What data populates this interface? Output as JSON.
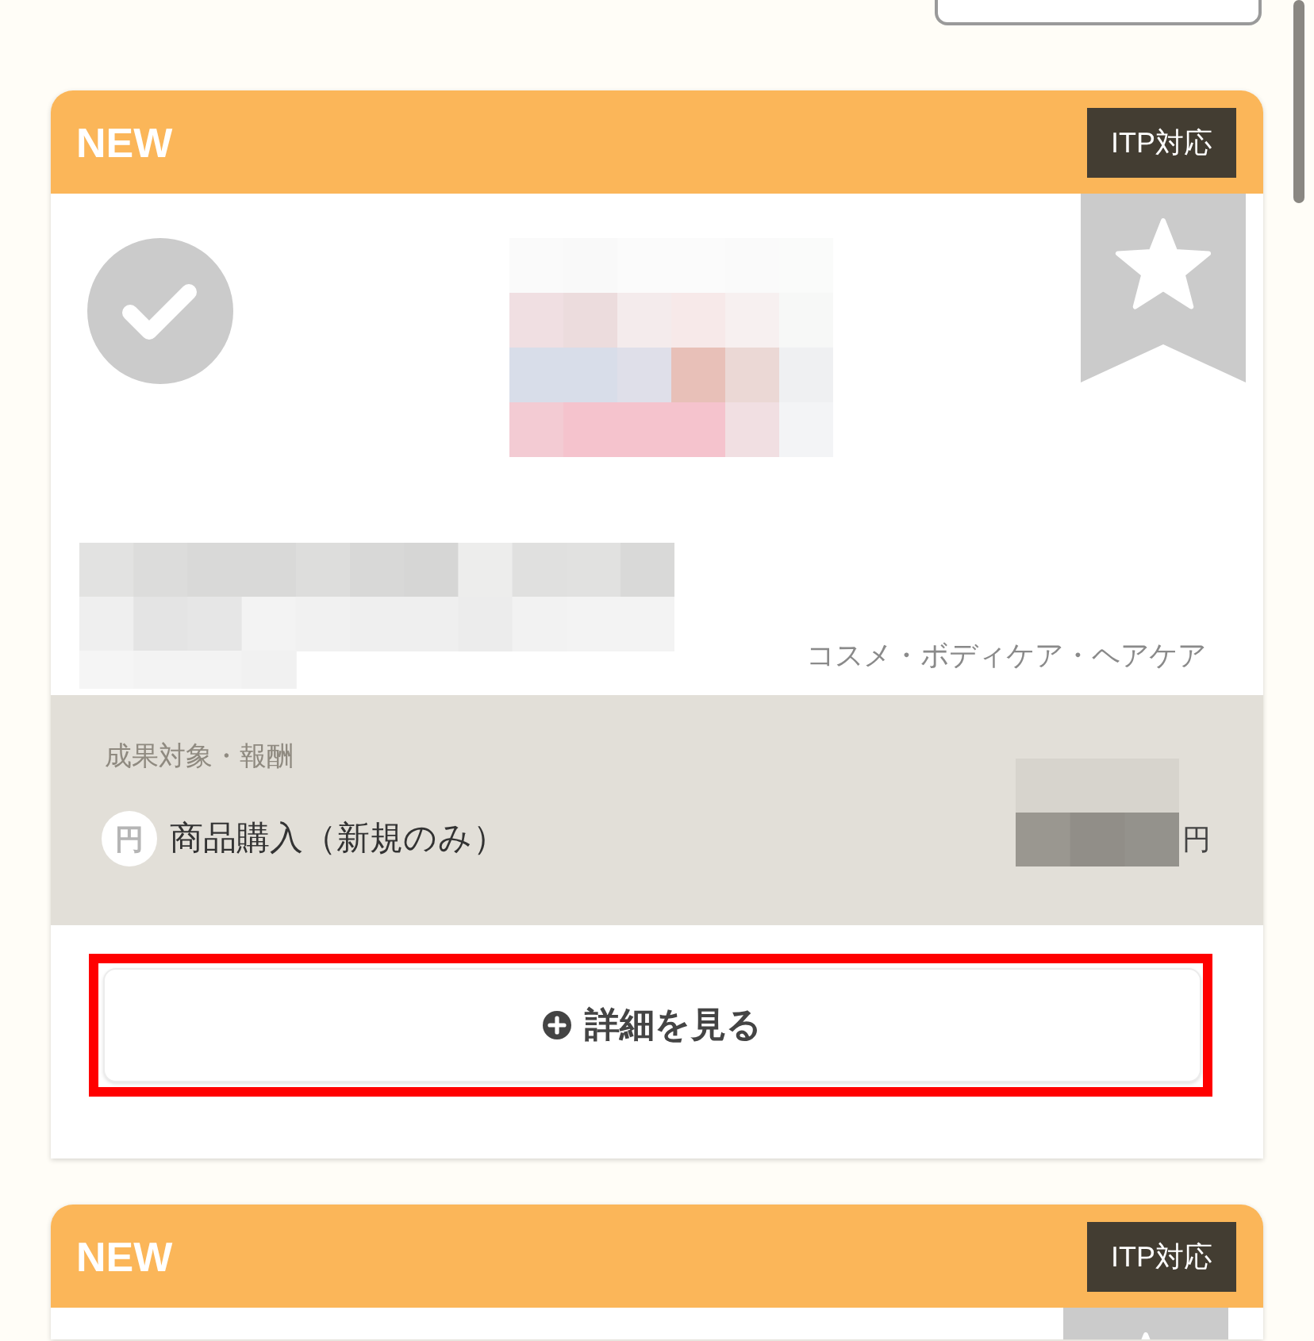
{
  "offers": [
    {
      "tag": "NEW",
      "badge": "ITP対応",
      "selected": false,
      "favorite": false,
      "category": "コスメ・ボディケア・ヘアケア",
      "reward": {
        "heading": "成果対象・報酬",
        "currency_badge": "円",
        "action": "商品購入（新規のみ）",
        "unit": "円"
      },
      "details_button": "詳細を見る",
      "highlighted": true
    },
    {
      "tag": "NEW",
      "badge": "ITP対応",
      "favorite": false
    }
  ]
}
